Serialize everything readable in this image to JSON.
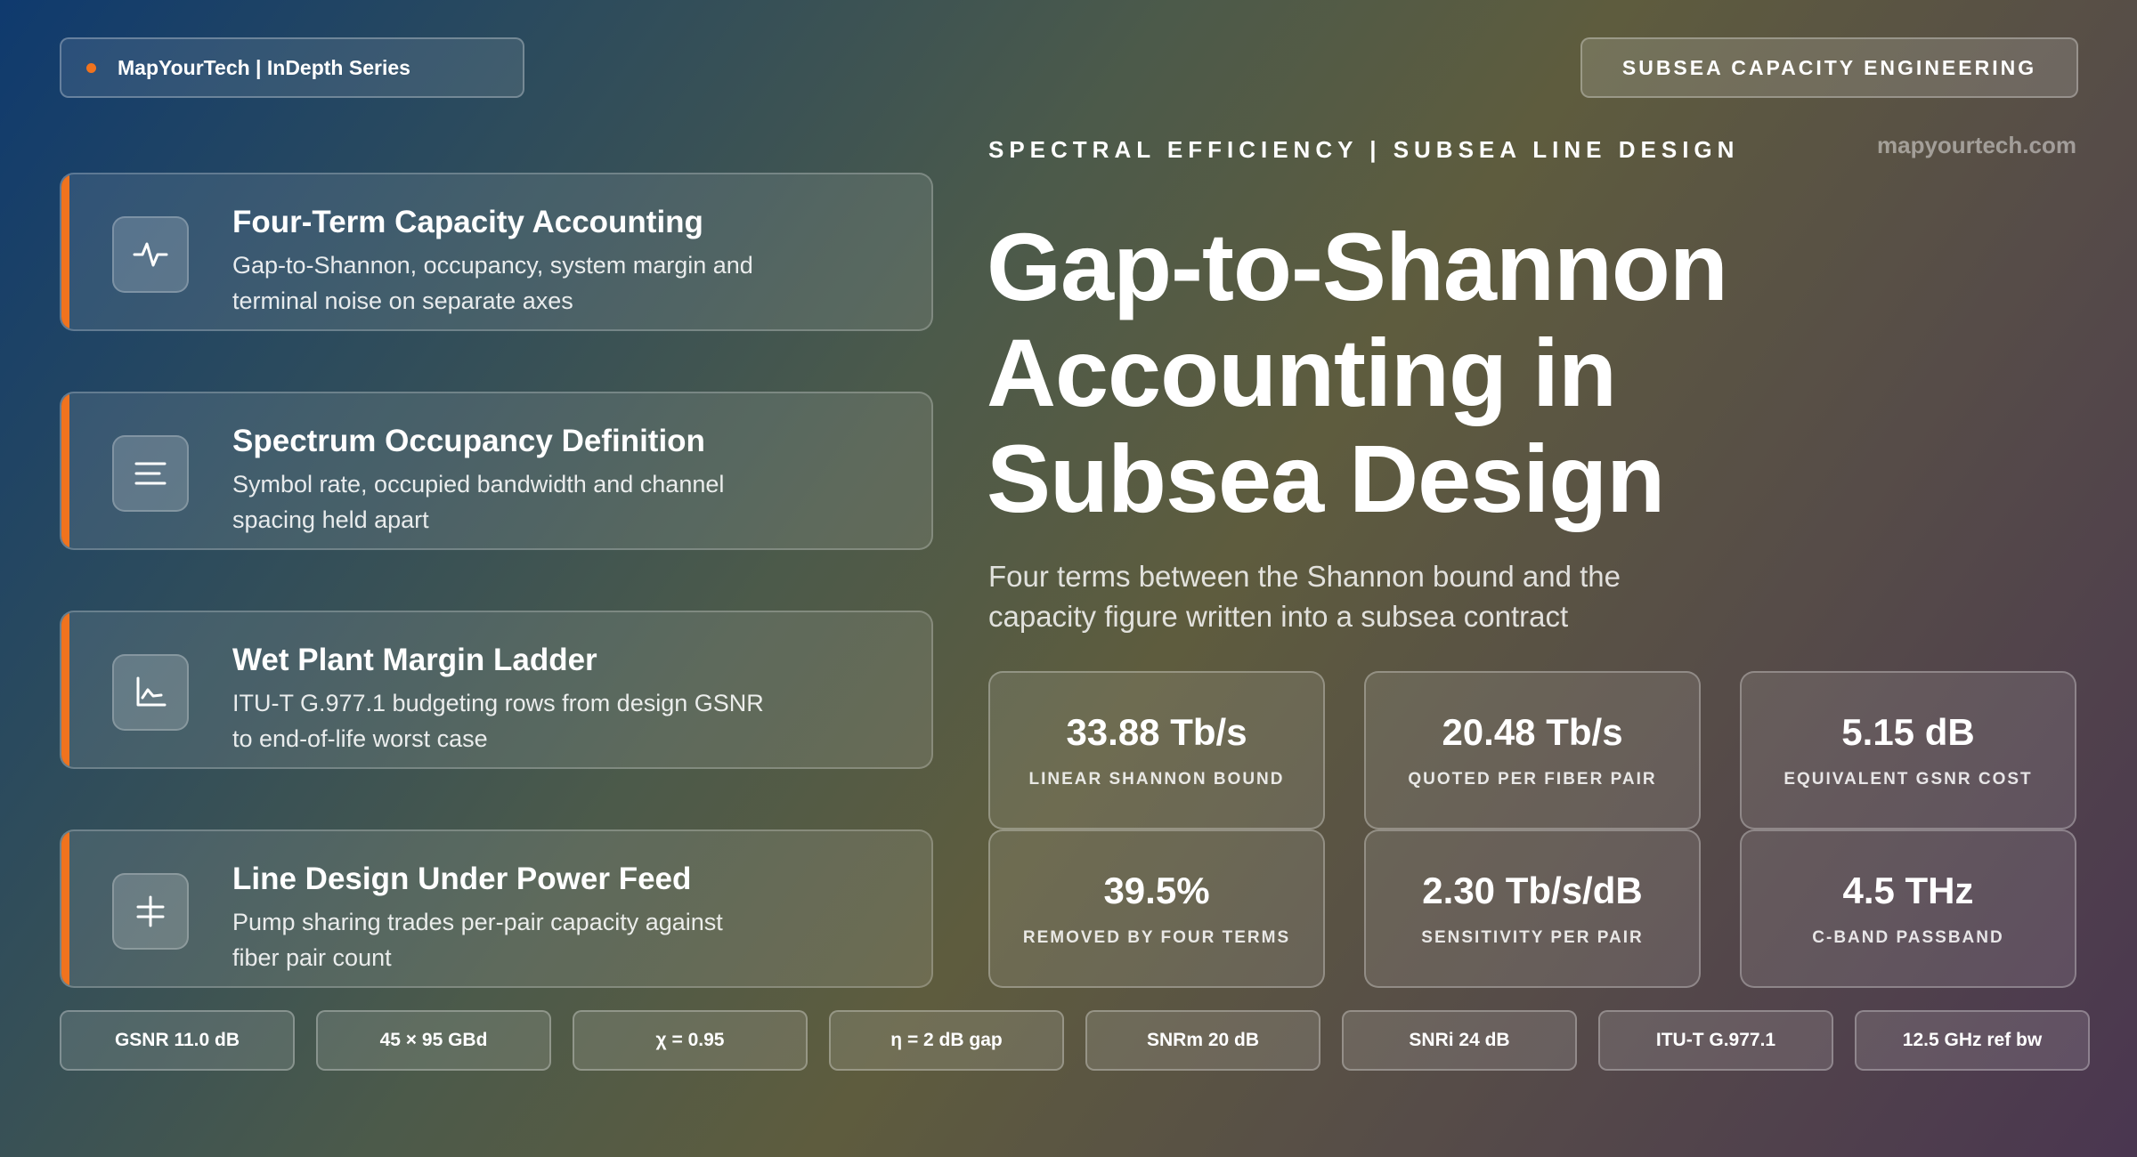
{
  "brand": {
    "label": "MapYourTech | InDepth Series",
    "accent": "#f0731e"
  },
  "tag": "SUBSEA CAPACITY ENGINEERING",
  "eyebrow": "SPECTRAL EFFICIENCY | SUBSEA LINE DESIGN",
  "site": "mapyourtech.com",
  "headline": {
    "line1": "Gap-to-Shannon",
    "line2": "Accounting in",
    "line3": "Subsea Design"
  },
  "subtitle": "Four terms between the Shannon bound and the capacity figure written into a subsea contract",
  "cards": [
    {
      "icon": "pulse-icon",
      "title": "Four-Term Capacity Accounting",
      "desc": "Gap-to-Shannon, occupancy, system margin and terminal noise on separate axes"
    },
    {
      "icon": "lines-icon",
      "title": "Spectrum Occupancy Definition",
      "desc": "Symbol rate, occupied bandwidth and channel spacing held apart"
    },
    {
      "icon": "chart-icon",
      "title": "Wet Plant Margin Ladder",
      "desc": "ITU-T G.977.1 budgeting rows from design GSNR to end-of-life worst case"
    },
    {
      "icon": "plus-minus-icon",
      "title": "Line Design Under Power Feed",
      "desc": "Pump sharing trades per-pair capacity against fiber pair count"
    }
  ],
  "stats": [
    {
      "value": "33.88 Tb/s",
      "label": "LINEAR SHANNON BOUND"
    },
    {
      "value": "20.48 Tb/s",
      "label": "QUOTED PER FIBER PAIR"
    },
    {
      "value": "5.15 dB",
      "label": "EQUIVALENT GSNR COST"
    },
    {
      "value": "39.5%",
      "label": "REMOVED BY FOUR TERMS"
    },
    {
      "value": "2.30 Tb/s/dB",
      "label": "SENSITIVITY PER PAIR"
    },
    {
      "value": "4.5 THz",
      "label": "C-BAND PASSBAND"
    }
  ],
  "chips": [
    "GSNR 11.0 dB",
    "45 × 95 GBd",
    "χ = 0.95",
    "η = 2 dB gap",
    "SNRm 20 dB",
    "SNRi 24 dB",
    "ITU-T G.977.1",
    "12.5 GHz ref bw"
  ]
}
